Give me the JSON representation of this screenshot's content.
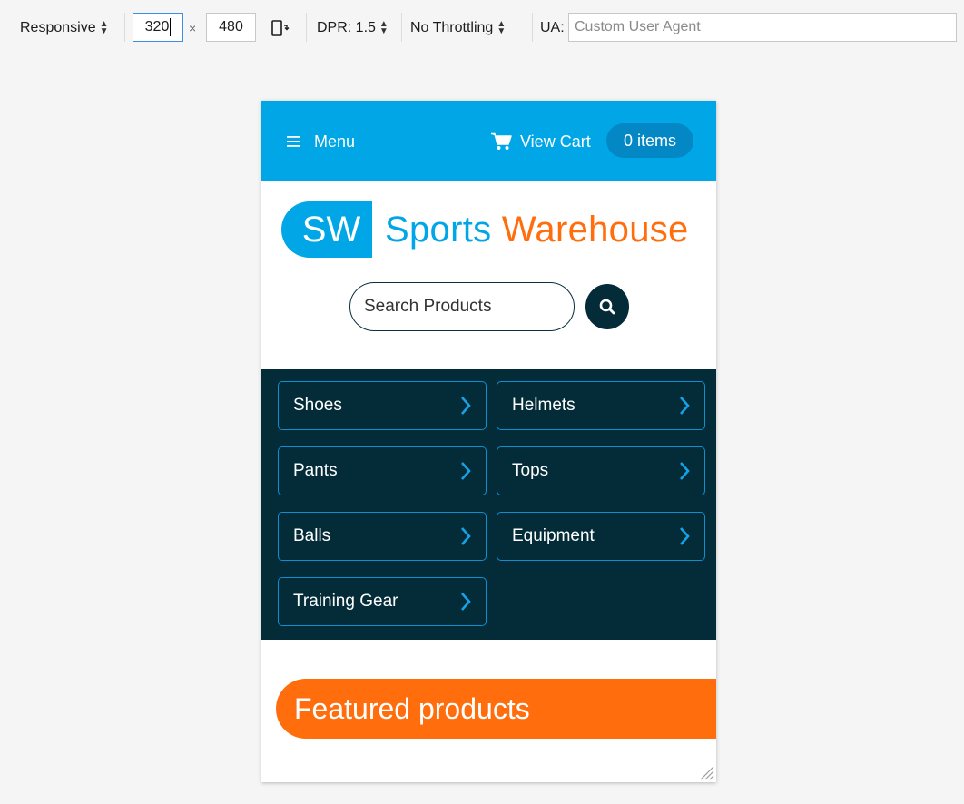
{
  "toolbar": {
    "device": "Responsive",
    "width": "320",
    "times": "×",
    "height": "480",
    "dpr": "DPR: 1.5",
    "throttling": "No Throttling",
    "ua_label": "UA:",
    "ua_placeholder": "Custom User Agent"
  },
  "site": {
    "menu_label": "Menu",
    "cart_label": "View Cart",
    "cart_count": "0 items",
    "logo_mark": "SW",
    "logo_word1": "Sports",
    "logo_word2": "Warehouse",
    "search_placeholder": "Search Products",
    "categories": [
      "Shoes",
      "Helmets",
      "Pants",
      "Tops",
      "Balls",
      "Equipment",
      "Training Gear"
    ],
    "featured_title": "Featured products"
  },
  "colors": {
    "brand_blue": "#00a6e6",
    "brand_orange": "#ff6d0d",
    "dark_navy": "#032b38"
  },
  "icons": [
    "hamburger-icon",
    "cart-icon",
    "search-icon",
    "chevron-right-icon",
    "rotate-device-icon",
    "resize-handle-icon"
  ]
}
